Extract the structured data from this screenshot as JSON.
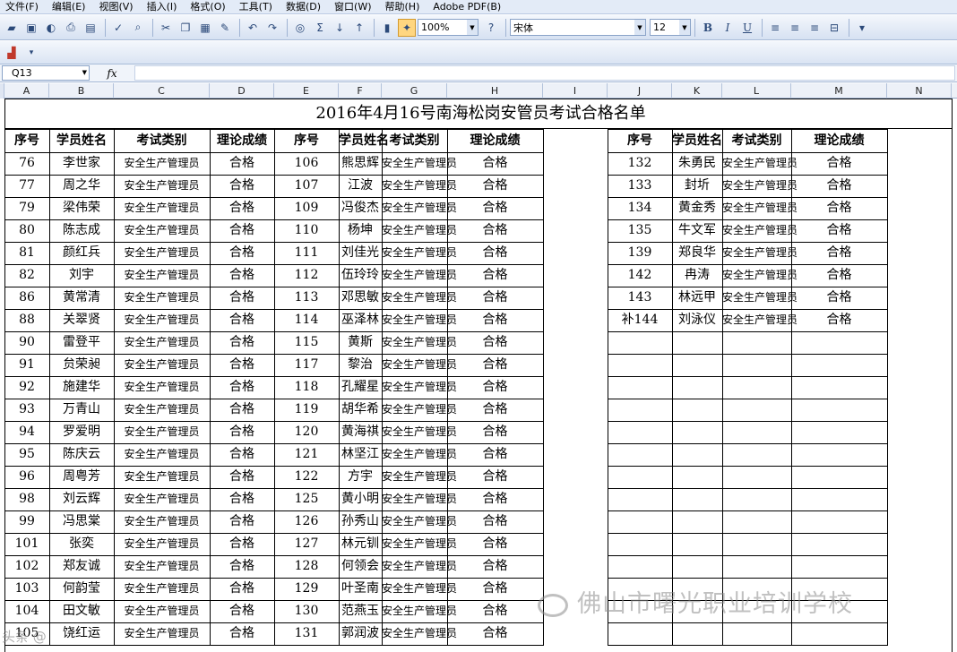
{
  "menu": [
    "文件(F)",
    "编辑(E)",
    "视图(V)",
    "插入(I)",
    "格式(O)",
    "工具(T)",
    "数据(D)",
    "窗口(W)",
    "帮助(H)",
    "Adobe PDF(B)"
  ],
  "toolbar": {
    "zoom": "100%",
    "font": "宋体",
    "size": "12",
    "bold": "B",
    "italic": "I",
    "underline": "U",
    "sigma": "Σ"
  },
  "name_box": "Q13",
  "fx_label": "fx",
  "columns": [
    "A",
    "B",
    "C",
    "D",
    "E",
    "F",
    "G",
    "H",
    "I",
    "J",
    "K",
    "L",
    "M",
    "N"
  ],
  "sheet": {
    "title": "2016年4月16号南海松岗安管员考试合格名单",
    "headers": [
      "序号",
      "学员姓名",
      "考试类别",
      "理论成绩"
    ],
    "block1": [
      [
        "76",
        "李世家",
        "安全生产管理员",
        "合格"
      ],
      [
        "77",
        "周之华",
        "安全生产管理员",
        "合格"
      ],
      [
        "79",
        "梁伟荣",
        "安全生产管理员",
        "合格"
      ],
      [
        "80",
        "陈志成",
        "安全生产管理员",
        "合格"
      ],
      [
        "81",
        "颜红兵",
        "安全生产管理员",
        "合格"
      ],
      [
        "82",
        "刘宇",
        "安全生产管理员",
        "合格"
      ],
      [
        "86",
        "黄常清",
        "安全生产管理员",
        "合格"
      ],
      [
        "88",
        "关翠贤",
        "安全生产管理员",
        "合格"
      ],
      [
        "90",
        "雷登平",
        "安全生产管理员",
        "合格"
      ],
      [
        "91",
        "贠荣昶",
        "安全生产管理员",
        "合格"
      ],
      [
        "92",
        "施建华",
        "安全生产管理员",
        "合格"
      ],
      [
        "93",
        "万青山",
        "安全生产管理员",
        "合格"
      ],
      [
        "94",
        "罗爱明",
        "安全生产管理员",
        "合格"
      ],
      [
        "95",
        "陈庆云",
        "安全生产管理员",
        "合格"
      ],
      [
        "96",
        "周粤芳",
        "安全生产管理员",
        "合格"
      ],
      [
        "98",
        "刘云辉",
        "安全生产管理员",
        "合格"
      ],
      [
        "99",
        "冯思棠",
        "安全生产管理员",
        "合格"
      ],
      [
        "101",
        "张奕",
        "安全生产管理员",
        "合格"
      ],
      [
        "102",
        "郑友诚",
        "安全生产管理员",
        "合格"
      ],
      [
        "103",
        "何韵莹",
        "安全生产管理员",
        "合格"
      ],
      [
        "104",
        "田文敏",
        "安全生产管理员",
        "合格"
      ],
      [
        "105",
        "饶红运",
        "安全生产管理员",
        "合格"
      ]
    ],
    "block2": [
      [
        "106",
        "熊思辉",
        "安全生产管理员",
        "合格"
      ],
      [
        "107",
        "江波",
        "安全生产管理员",
        "合格"
      ],
      [
        "109",
        "冯俊杰",
        "安全生产管理员",
        "合格"
      ],
      [
        "110",
        "杨坤",
        "安全生产管理员",
        "合格"
      ],
      [
        "111",
        "刘佳光",
        "安全生产管理员",
        "合格"
      ],
      [
        "112",
        "伍玲玲",
        "安全生产管理员",
        "合格"
      ],
      [
        "113",
        "邓思敏",
        "安全生产管理员",
        "合格"
      ],
      [
        "114",
        "巫泽林",
        "安全生产管理员",
        "合格"
      ],
      [
        "115",
        "黄斯",
        "安全生产管理员",
        "合格"
      ],
      [
        "117",
        "黎治",
        "安全生产管理员",
        "合格"
      ],
      [
        "118",
        "孔耀星",
        "安全生产管理员",
        "合格"
      ],
      [
        "119",
        "胡华希",
        "安全生产管理员",
        "合格"
      ],
      [
        "120",
        "黄海祺",
        "安全生产管理员",
        "合格"
      ],
      [
        "121",
        "林坚江",
        "安全生产管理员",
        "合格"
      ],
      [
        "122",
        "方宇",
        "安全生产管理员",
        "合格"
      ],
      [
        "125",
        "黄小明",
        "安全生产管理员",
        "合格"
      ],
      [
        "126",
        "孙秀山",
        "安全生产管理员",
        "合格"
      ],
      [
        "127",
        "林元钏",
        "安全生产管理员",
        "合格"
      ],
      [
        "128",
        "何领会",
        "安全生产管理员",
        "合格"
      ],
      [
        "129",
        "叶圣南",
        "安全生产管理员",
        "合格"
      ],
      [
        "130",
        "范燕玉",
        "安全生产管理员",
        "合格"
      ],
      [
        "131",
        "郭润波",
        "安全生产管理员",
        "合格"
      ]
    ],
    "block3": [
      [
        "132",
        "朱勇民",
        "安全生产管理员",
        "合格"
      ],
      [
        "133",
        "封圻",
        "安全生产管理员",
        "合格"
      ],
      [
        "134",
        "黄金秀",
        "安全生产管理员",
        "合格"
      ],
      [
        "135",
        "牛文军",
        "安全生产管理员",
        "合格"
      ],
      [
        "139",
        "郑良华",
        "安全生产管理员",
        "合格"
      ],
      [
        "142",
        "冉涛",
        "安全生产管理员",
        "合格"
      ],
      [
        "143",
        "林远甲",
        "安全生产管理员",
        "合格"
      ],
      [
        "补144",
        "刘泳仪",
        "安全生产管理员",
        "合格"
      ]
    ]
  },
  "watermark": "佛山市曙光职业培训学校",
  "watermark_small": "头条 @"
}
